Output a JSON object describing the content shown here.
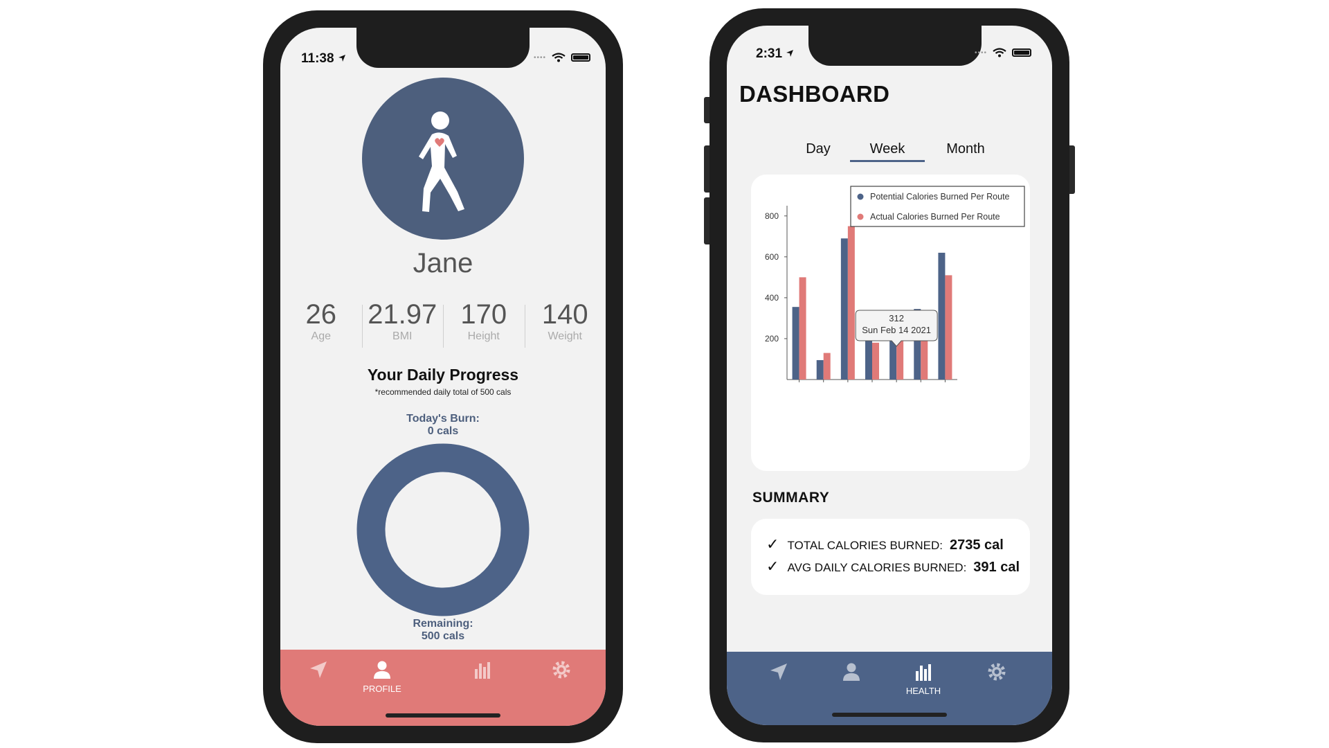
{
  "left_phone": {
    "status": {
      "time": "11:38"
    },
    "profile": {
      "name": "Jane",
      "stats": [
        {
          "value": "26",
          "label": "Age"
        },
        {
          "value": "21.97",
          "label": "BMI"
        },
        {
          "value": "170",
          "label": "Height"
        },
        {
          "value": "140",
          "label": "Weight"
        }
      ]
    },
    "progress": {
      "title": "Your Daily Progress",
      "note": "*recommended daily total of 500 cals",
      "burn_label": "Today's Burn:",
      "burn_value": "0 cals",
      "remaining_label": "Remaining:",
      "remaining_value": "500 cals",
      "fraction_burned": 0
    },
    "tabbar": {
      "color": "#e07a78",
      "tabs": [
        {
          "icon": "location-arrow-icon",
          "label": ""
        },
        {
          "icon": "person-icon",
          "label": "PROFILE",
          "active": true
        },
        {
          "icon": "bar-chart-icon",
          "label": ""
        },
        {
          "icon": "gear-icon",
          "label": ""
        }
      ]
    }
  },
  "right_phone": {
    "status": {
      "time": "2:31"
    },
    "title": "DASHBOARD",
    "segments": [
      "Day",
      "Week",
      "Month"
    ],
    "selected_segment": "Week",
    "summary": {
      "title": "SUMMARY",
      "rows": [
        {
          "label": "TOTAL CALORIES BURNED:",
          "value": "2735 cal"
        },
        {
          "label": "AVG DAILY CALORIES BURNED:",
          "value": "391 cal"
        }
      ]
    },
    "tabbar": {
      "color": "#4d6388",
      "tabs": [
        {
          "icon": "location-arrow-icon",
          "label": ""
        },
        {
          "icon": "person-icon",
          "label": ""
        },
        {
          "icon": "bar-chart-icon",
          "label": "HEALTH",
          "active": true
        },
        {
          "icon": "gear-icon",
          "label": ""
        }
      ]
    }
  },
  "colors": {
    "primary": "#4d6388",
    "accent": "#e07a78",
    "avatar": "#4d5f7d"
  },
  "chart_data": {
    "type": "bar",
    "categories": [
      "",
      "",
      "",
      "",
      "",
      "",
      ""
    ],
    "series": [
      {
        "name": "Potential Calories Burned Per Route",
        "color": "#4d6388",
        "values": [
          355,
          95,
          690,
          235,
          312,
          345,
          620
        ]
      },
      {
        "name": "Actual Calories Burned Per Route",
        "color": "#e07a78",
        "values": [
          500,
          130,
          750,
          180,
          312,
          340,
          510
        ]
      }
    ],
    "ylim": [
      0,
      850
    ],
    "yticks": [
      200,
      400,
      600,
      800
    ],
    "legend": "top-right",
    "grid": false,
    "tooltip": {
      "value": "312",
      "date": "Sun Feb 14 2021",
      "index": 4
    }
  }
}
